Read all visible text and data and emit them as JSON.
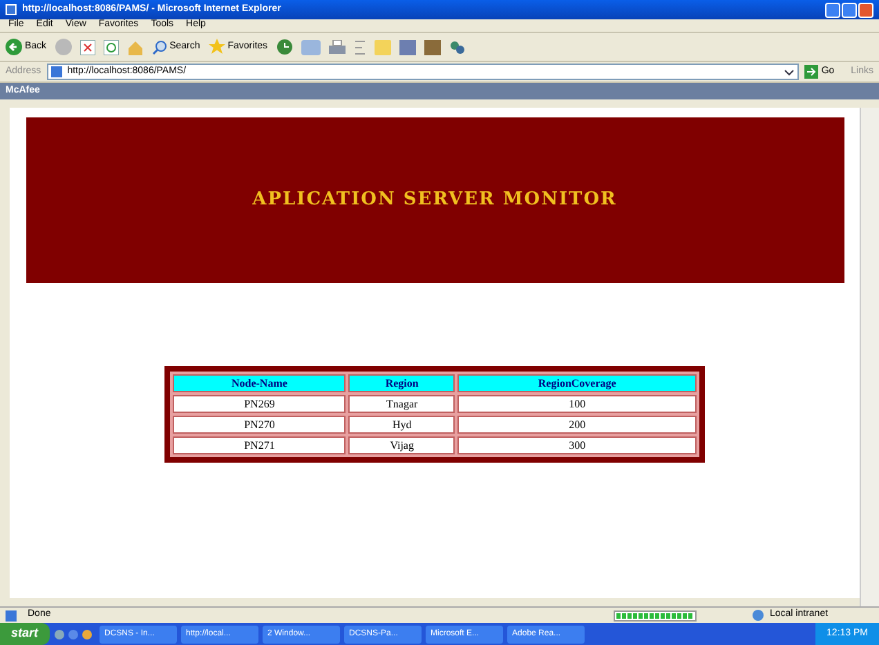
{
  "window": {
    "title": "http://localhost:8086/PAMS/ - Microsoft Internet Explorer"
  },
  "menu": [
    "File",
    "Edit",
    "View",
    "Favorites",
    "Tools",
    "Help"
  ],
  "toolbar": {
    "back": "Back",
    "search": "Search",
    "favorites": "Favorites"
  },
  "address": {
    "label": "Address",
    "url": "http://localhost:8086/PAMS/",
    "go": "Go",
    "links": "Links"
  },
  "mcafee": {
    "label": "McAfee"
  },
  "page": {
    "heading": "APLICATION SERVER MONITOR",
    "table": {
      "columns": [
        "Node-Name",
        "Region",
        "RegionCoverage"
      ],
      "rows": [
        [
          "PN269",
          "Tnagar",
          "100"
        ],
        [
          "PN270",
          "Hyd",
          "200"
        ],
        [
          "PN271",
          "Vijag",
          "300"
        ]
      ]
    }
  },
  "status_bar": {
    "text": "Done",
    "progress": {
      "level": 1
    },
    "zone": "Local intranet"
  },
  "taskbar": {
    "start": "start",
    "tasks": [
      "DCSNS - In...",
      "http://local...",
      "2 Window...",
      "DCSNS-Pa...",
      "Microsoft E...",
      "Adobe Rea..."
    ],
    "clock": "12:13 PM"
  }
}
